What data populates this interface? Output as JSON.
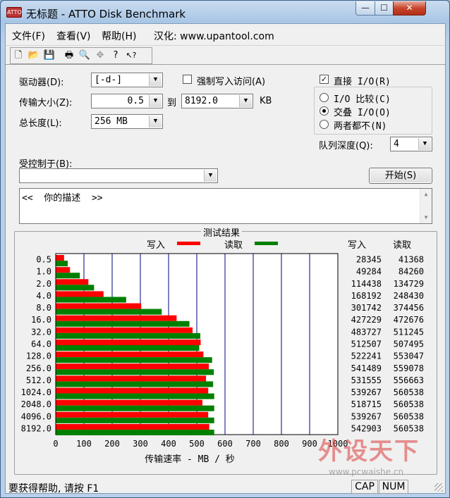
{
  "window": {
    "title": "无标题 - ATTO Disk Benchmark",
    "icon_label": "ATTO",
    "min_glyph": "—",
    "max_glyph": "☐",
    "close_glyph": "✕"
  },
  "menu": {
    "file": "文件(F)",
    "view": "查看(V)",
    "help": "帮助(H)",
    "localized": "汉化: www.upantool.com"
  },
  "toolbar": {
    "icons": [
      "new-icon",
      "open-icon",
      "save-icon",
      "print-icon",
      "print-preview-icon",
      "move-icon",
      "help-icon",
      "context-help-icon"
    ],
    "glyphs": [
      "🗋",
      "📂",
      "💾",
      "🖶",
      "🔍",
      "✥",
      "?",
      "↖?"
    ]
  },
  "settings": {
    "drive_label": "驱动器(D):",
    "drive_value": "[-d-]",
    "force_write_label": "强制写入访问(A)",
    "force_write_checked": false,
    "direct_io_label": "直接 I/O(R)",
    "direct_io_checked": true,
    "transfer_label": "传输大小(Z):",
    "transfer_from": "0.5",
    "to_label": "到",
    "transfer_to": "8192.0",
    "unit": "KB",
    "length_label": "总长度(L):",
    "length_value": "256 MB",
    "io_compare_label": "I/O 比较(C)",
    "io_overlap_label": "交叠 I/O(O)",
    "io_neither_label": "两者都不(N)",
    "io_mode_selected": "overlap",
    "queue_label": "队列深度(Q):",
    "queue_value": "4",
    "controlled_label": "受控制于(B):",
    "controlled_value": "",
    "start_label": "开始(S)",
    "description": "<<  你的描述  >>",
    "check_glyph": "✓",
    "dropdown_glyph": "▼",
    "scroll_up_glyph": "▲",
    "scroll_down_glyph": "▼"
  },
  "results": {
    "title": "测试结果",
    "write_legend": "写入",
    "read_legend": "读取",
    "write_header": "写入",
    "read_header": "读取"
  },
  "chart_data": {
    "type": "bar",
    "orientation": "horizontal",
    "title": "测试结果",
    "xlabel": "传输速率 - MB / 秒",
    "xlim": [
      0,
      1000
    ],
    "xticks": [
      "0",
      "100",
      "200",
      "300",
      "400",
      "500",
      "600",
      "700",
      "800",
      "900",
      "1000"
    ],
    "categories": [
      "0.5",
      "1.0",
      "2.0",
      "4.0",
      "8.0",
      "16.0",
      "32.0",
      "64.0",
      "128.0",
      "256.0",
      "512.0",
      "1024.0",
      "2048.0",
      "4096.0",
      "8192.0"
    ],
    "series": [
      {
        "name": "写入",
        "color": "#ff0000",
        "values": [
          28.345,
          49.284,
          114.438,
          168.192,
          301.742,
          427.229,
          483.727,
          512.507,
          522.241,
          541.489,
          531.555,
          539.267,
          518.715,
          539.267,
          542.903
        ],
        "labels": [
          "28345",
          "49284",
          "114438",
          "168192",
          "301742",
          "427229",
          "483727",
          "512507",
          "522241",
          "541489",
          "531555",
          "539267",
          "518715",
          "539267",
          "542903"
        ]
      },
      {
        "name": "读取",
        "color": "#008000",
        "values": [
          41.368,
          84.26,
          134.729,
          248.43,
          374.456,
          472.676,
          511.245,
          507.495,
          553.047,
          559.078,
          556.663,
          560.538,
          560.538,
          560.538,
          560.538
        ],
        "labels": [
          "41368",
          "84260",
          "134729",
          "248430",
          "374456",
          "472676",
          "511245",
          "507495",
          "553047",
          "559078",
          "556663",
          "560538",
          "560538",
          "560538",
          "560538"
        ]
      }
    ],
    "grid": true
  },
  "status": {
    "help_text": "要获得帮助, 请按 F1",
    "cap": "CAP",
    "num": "NUM"
  },
  "watermark": {
    "text": "外设天下",
    "url": "www.pcwaishe.cn"
  }
}
